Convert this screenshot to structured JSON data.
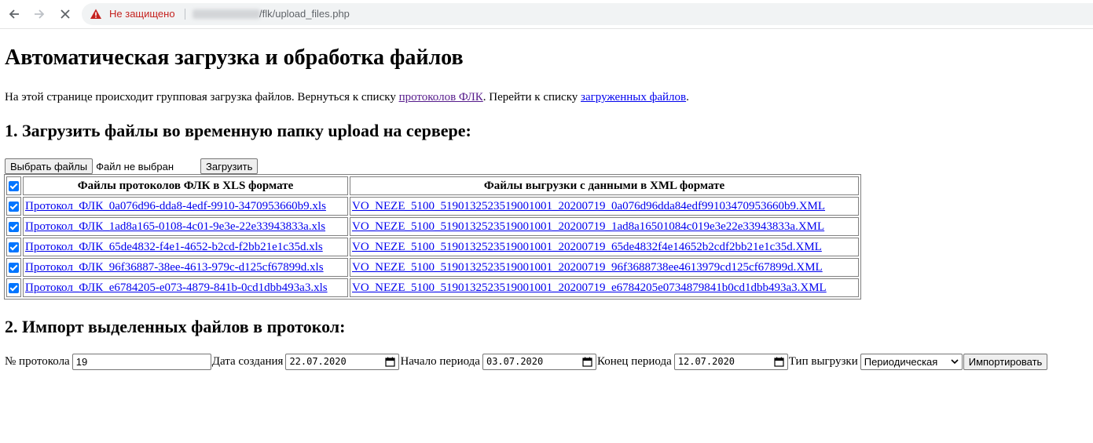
{
  "browser": {
    "not_secure": "Не защищено",
    "url_path": "/flk/upload_files.php"
  },
  "page": {
    "title": "Автоматическая загрузка и обработка файлов",
    "intro": {
      "text1": "На этой странице происходит групповая загрузка файлов. Вернуться к списку ",
      "link1": "протоколов ФЛК",
      "text2": ". Перейти к списку ",
      "link2": "загруженных файлов",
      "text3": "."
    }
  },
  "upload": {
    "heading": "1. Загрузить файлы во временную папку upload на сервере:",
    "choose_button": "Выбрать файлы",
    "no_file_text": "Файл не выбран",
    "upload_button": "Загрузить"
  },
  "files_table": {
    "headers": [
      "Файлы протоколов ФЛК в XLS формате",
      "Файлы выгрузки с данными в XML формате"
    ],
    "header_checked": true,
    "rows": [
      {
        "checked": true,
        "xls": "Протокол_ФЛК_0a076d96-dda8-4edf-9910-3470953660b9.xls",
        "xml": "VO_NEZE_5100_5190132523519001001_20200719_0a076d96dda84edf99103470953660b9.XML"
      },
      {
        "checked": true,
        "xls": "Протокол_ФЛК_1ad8a165-0108-4c01-9e3e-22e33943833a.xls",
        "xml": "VO_NEZE_5100_5190132523519001001_20200719_1ad8a16501084c019e3e22e33943833a.XML"
      },
      {
        "checked": true,
        "xls": "Протокол_ФЛК_65de4832-f4e1-4652-b2cd-f2bb21e1c35d.xls",
        "xml": "VO_NEZE_5100_5190132523519001001_20200719_65de4832f4e14652b2cdf2bb21e1c35d.XML"
      },
      {
        "checked": true,
        "xls": "Протокол_ФЛК_96f36887-38ee-4613-979c-d125cf67899d.xls",
        "xml": "VO_NEZE_5100_5190132523519001001_20200719_96f3688738ee4613979cd125cf67899d.XML"
      },
      {
        "checked": true,
        "xls": "Протокол_ФЛК_e6784205-e073-4879-841b-0cd1dbb493a3.xls",
        "xml": "VO_NEZE_5100_5190132523519001001_20200719_e6784205e0734879841b0cd1dbb493a3.XML"
      }
    ]
  },
  "import": {
    "heading": "2. Импорт выделенных файлов в протокол:",
    "protocol_label": "№ протокола",
    "protocol_value": "19",
    "created_label": "Дата создания",
    "created_value": "22.07.2020",
    "start_label": "Начало периода",
    "start_value": "03.07.2020",
    "end_label": "Конец периода",
    "end_value": "12.07.2020",
    "type_label": "Тип выгрузки",
    "type_value": "Периодическая",
    "import_button": "Импортировать"
  },
  "colors": {
    "link": "#0000ee",
    "visited_link": "#551a8b",
    "checkbox": "#0075ff",
    "not_secure": "#c5221f"
  }
}
